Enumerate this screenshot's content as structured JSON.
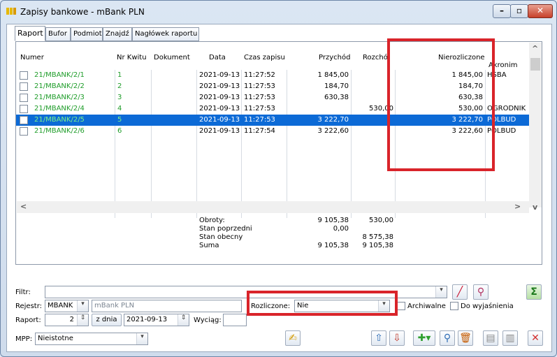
{
  "window": {
    "title": "Zapisy bankowe - mBank PLN"
  },
  "tabs": [
    {
      "label": "Raport"
    },
    {
      "label": "Bufor"
    },
    {
      "label": "Podmiot"
    },
    {
      "label": "Znajdź"
    },
    {
      "label": "Nagłówek raportu"
    }
  ],
  "grid": {
    "headers": {
      "numer": "Numer",
      "nr_kwitu": "Nr Kwitu",
      "dokument": "Dokument",
      "data": "Data",
      "czas": "Czas zapisu",
      "przychod": "Przychód",
      "rozchod": "Rozchó",
      "nierozliczone": "Nierozliczone",
      "akronim": "Akronim"
    },
    "rows": [
      {
        "numer": "21/MBANK/2/1",
        "nr_kwitu": "1",
        "data": "2021-09-13",
        "czas": "11:27:52",
        "przychod": "1 845,00",
        "rozchod": "",
        "nierozliczone": "1 845,00",
        "akronim": "HSBA"
      },
      {
        "numer": "21/MBANK/2/2",
        "nr_kwitu": "2",
        "data": "2021-09-13",
        "czas": "11:27:53",
        "przychod": "184,70",
        "rozchod": "",
        "nierozliczone": "184,70",
        "akronim": ""
      },
      {
        "numer": "21/MBANK/2/3",
        "nr_kwitu": "3",
        "data": "2021-09-13",
        "czas": "11:27:53",
        "przychod": "630,38",
        "rozchod": "",
        "nierozliczone": "630,38",
        "akronim": ""
      },
      {
        "numer": "21/MBANK/2/4",
        "nr_kwitu": "4",
        "data": "2021-09-13",
        "czas": "11:27:53",
        "przychod": "",
        "rozchod": "530,00",
        "nierozliczone": "530,00",
        "akronim": "OGRODNIK"
      },
      {
        "numer": "21/MBANK/2/5",
        "nr_kwitu": "5",
        "data": "2021-09-13",
        "czas": "11:27:53",
        "przychod": "3 222,70",
        "rozchod": "",
        "nierozliczone": "3 222,70",
        "akronim": "POLBUD"
      },
      {
        "numer": "21/MBANK/2/6",
        "nr_kwitu": "6",
        "data": "2021-09-13",
        "czas": "11:27:54",
        "przychod": "3 222,60",
        "rozchod": "",
        "nierozliczone": "3 222,60",
        "akronim": "POLBUD"
      }
    ],
    "selected_row": 4
  },
  "summary": {
    "labels": [
      "Obroty:",
      "Stan poprzedni",
      "Stan obecny",
      "Suma"
    ],
    "przychod": [
      "9 105,38",
      "0,00",
      "",
      "9 105,38"
    ],
    "rozchod": [
      "530,00",
      "",
      "8 575,38",
      "9 105,38"
    ]
  },
  "form": {
    "filtr_label": "Filtr:",
    "rejestr_label": "Rejestr:",
    "rejestr_value": "MBANK",
    "rejestr_name": "mBank PLN",
    "raport_label": "Raport:",
    "raport_value": "2",
    "z_dnia_label": "z dnia",
    "z_dnia_value": "2021-09-13",
    "wyciag_label": "Wyciąg:",
    "rozliczone_label": "Rozliczone:",
    "rozliczone_value": "Nie",
    "archiwalne_label": "Archiwalne",
    "do_wyjasnienia_label": "Do wyjaśnienia",
    "mpp_label": "MPP:",
    "mpp_value": "Nieistotne"
  },
  "colors": {
    "highlight": "#d9242a",
    "selection": "#0c6ad6",
    "green_text": "#1f9d2a"
  }
}
